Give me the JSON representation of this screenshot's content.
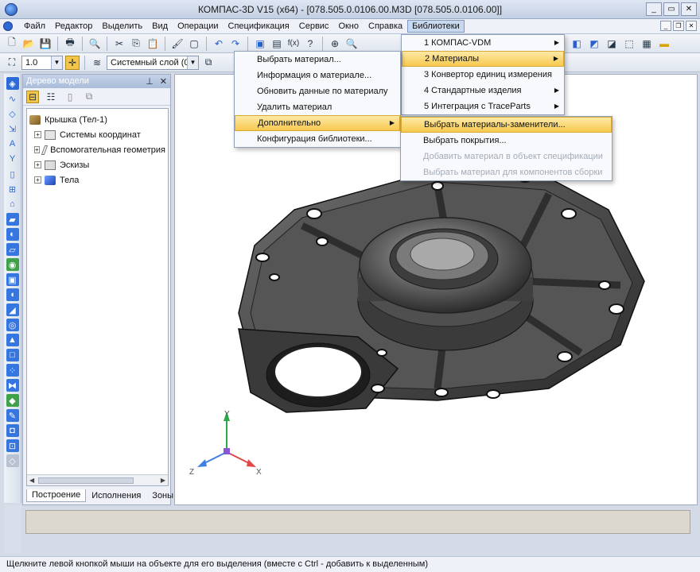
{
  "window": {
    "title": "КОМПАС-3D V15 (x64) - [078.505.0.0106.00.M3D [078.505.0.0106.00]]"
  },
  "menubar": {
    "items": [
      "Файл",
      "Редактор",
      "Выделить",
      "Вид",
      "Операции",
      "Спецификация",
      "Сервис",
      "Окно",
      "Справка",
      "Библиотеки"
    ]
  },
  "toolbar2": {
    "scale_value": "1.0",
    "layer_value": "Системный слой (0)"
  },
  "tree": {
    "title": "Дерево модели",
    "root": "Крышка (Тел-1)",
    "nodes": [
      "Системы координат",
      "Вспомогательная геометрия",
      "Эскизы",
      "Тела"
    ],
    "tabs": [
      "Построение",
      "Исполнения",
      "Зоны"
    ]
  },
  "menus": {
    "libraries": [
      "1 КОМПАС-VDM",
      "2 Материалы",
      "3 Конвертор единиц измерения",
      "4 Стандартные изделия",
      "5 Интеграция с TraceParts"
    ],
    "materials": [
      "Выбрать материал...",
      "Информация о материале...",
      "Обновить данные по материалу",
      "Удалить материал",
      "Дополнительно",
      "Конфигурация библиотеки..."
    ],
    "additional": [
      "Выбрать материалы-заменители...",
      "Выбрать покрытия...",
      "Добавить материал в объект спецификации",
      "Выбрать материал для компонентов сборки"
    ]
  },
  "triad": {
    "x": "X",
    "y": "Y",
    "z": "Z"
  },
  "status": {
    "text": "Щелкните левой кнопкой мыши на объекте для его выделения (вместе с Ctrl - добавить к выделенным)"
  },
  "colors": {
    "highlight": "#f7c94f",
    "accent": "#2f6ad6",
    "part": "#3a3a3a"
  }
}
